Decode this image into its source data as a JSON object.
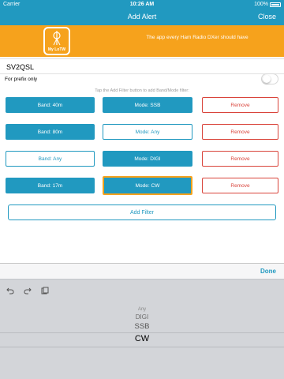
{
  "status_bar": {
    "carrier": "Carrier",
    "time": "10:26 AM",
    "battery": "100%"
  },
  "nav": {
    "title": "Add Alert",
    "close_label": "Close"
  },
  "banner": {
    "logo_text": "My LoTW",
    "tagline": "The app every Ham Radio DXer should have",
    "color": "#f6a21c"
  },
  "callsign": {
    "value": "SV2QSL"
  },
  "prefix": {
    "label": "For prefix only",
    "on": false
  },
  "hint": "Tap the Add Filter button to add Band/Mode filter:",
  "filters": [
    {
      "band": "Band: 40m",
      "mode": "Mode: SSB",
      "remove": "Remove"
    },
    {
      "band": "Band: 80m",
      "mode": "Mode: Any",
      "remove": "Remove"
    },
    {
      "band": "Band: Any",
      "mode": "Mode: DIGI",
      "remove": "Remove"
    },
    {
      "band": "Band: 17m",
      "mode": "Mode: CW",
      "remove": "Remove"
    }
  ],
  "add_filter_label": "Add Filter",
  "picker": {
    "done_label": "Done",
    "options": [
      "Any",
      "DIGI",
      "SSB",
      "CW"
    ],
    "selected": "CW"
  },
  "toolbar_icons": [
    "undo-icon",
    "redo-icon",
    "paste-icon"
  ],
  "colors": {
    "accent": "#2199c0",
    "remove": "#d9443b",
    "highlight": "#f6a21c"
  }
}
